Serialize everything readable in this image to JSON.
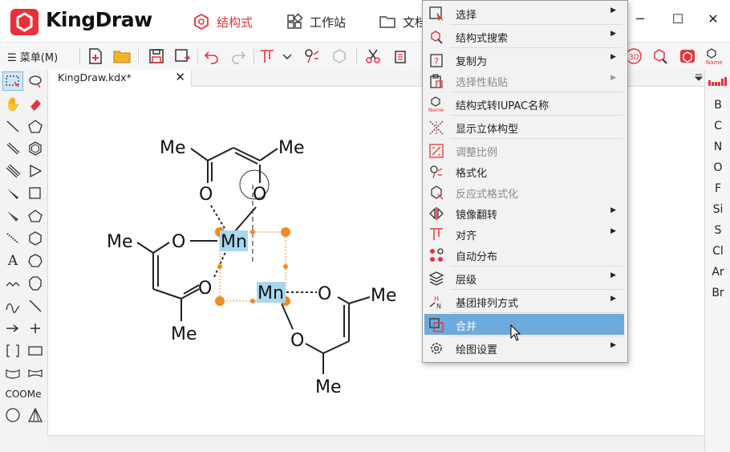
{
  "app": {
    "name": "KingDraw"
  },
  "nav_tabs": [
    {
      "label": "结构式",
      "active": true
    },
    {
      "label": "工作站",
      "active": false
    },
    {
      "label": "文档",
      "active": false
    }
  ],
  "window_controls": {
    "minimize": "─",
    "maximize": "☐",
    "close": "✕"
  },
  "toolbar": {
    "menu_label": "菜单(M)"
  },
  "document_tab": {
    "title": "KingDraw.kdx*",
    "close": "✕"
  },
  "lefttools": {
    "text_tool": "A",
    "coome": "COOMe"
  },
  "elements": [
    "B",
    "C",
    "N",
    "O",
    "F",
    "Si",
    "S",
    "Cl",
    "Ar",
    "Br"
  ],
  "molecule": {
    "atoms": {
      "me1": "Me",
      "me2": "Me",
      "me3": "Me",
      "me4": "Me",
      "me5": "Me",
      "me6": "Me",
      "o1": "O",
      "o2": "O",
      "o3": "O",
      "o4": "O",
      "o5": "O",
      "o6": "O",
      "mn1": "Mn",
      "mn2": "Mn"
    }
  },
  "context_menu": {
    "items": [
      {
        "label": "选择",
        "submenu": true,
        "disabled": false
      },
      {
        "label": "结构式搜索",
        "submenu": true,
        "disabled": false
      },
      {
        "label": "复制为",
        "submenu": true,
        "disabled": false
      },
      {
        "label": "选择性粘贴",
        "submenu": true,
        "disabled": true
      },
      {
        "label": "结构式转IUPAC名称",
        "submenu": false,
        "disabled": false
      },
      {
        "label": "显示立体构型",
        "submenu": false,
        "disabled": false
      },
      {
        "label": "调整比例",
        "submenu": false,
        "disabled": true
      },
      {
        "label": "格式化",
        "submenu": false,
        "disabled": false
      },
      {
        "label": "反应式格式化",
        "submenu": false,
        "disabled": true
      },
      {
        "label": "镜像翻转",
        "submenu": true,
        "disabled": false
      },
      {
        "label": "对齐",
        "submenu": true,
        "disabled": false
      },
      {
        "label": "自动分布",
        "submenu": false,
        "disabled": false
      },
      {
        "label": "层级",
        "submenu": true,
        "disabled": false
      },
      {
        "label": "基团排列方式",
        "submenu": true,
        "disabled": false
      },
      {
        "label": "合并",
        "submenu": false,
        "disabled": false,
        "highlighted": true
      },
      {
        "label": "绘图设置",
        "submenu": true,
        "disabled": false
      }
    ],
    "arrow": "▶"
  }
}
